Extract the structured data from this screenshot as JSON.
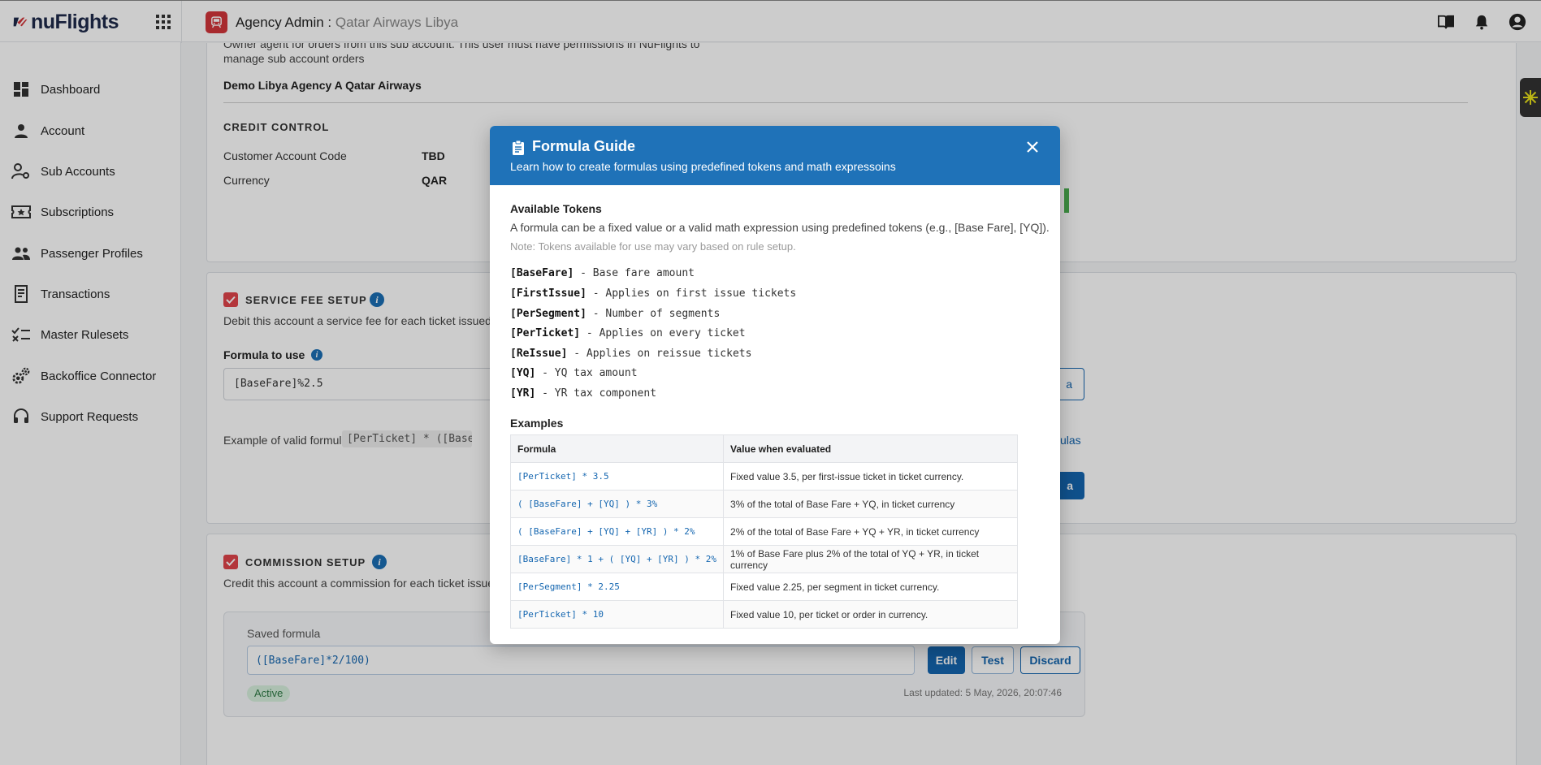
{
  "topbar": {
    "logo_text": "nuFlights",
    "agency_label": "Agency Admin : ",
    "agency_name": "Qatar Airways Libya"
  },
  "sidebar": {
    "items": [
      {
        "label": "Dashboard",
        "icon": "dashboard-icon"
      },
      {
        "label": "Account",
        "icon": "person-icon"
      },
      {
        "label": "Sub Accounts",
        "icon": "people-settings-icon"
      },
      {
        "label": "Subscriptions",
        "icon": "ticket-icon"
      },
      {
        "label": "Passenger Profiles",
        "icon": "group-icon"
      },
      {
        "label": "Transactions",
        "icon": "receipt-icon"
      },
      {
        "label": "Master Rulesets",
        "icon": "checklist-icon"
      },
      {
        "label": "Backoffice Connector",
        "icon": "gears-icon"
      },
      {
        "label": "Support Requests",
        "icon": "headset-icon"
      }
    ]
  },
  "main": {
    "owner_text_1": "Owner agent for orders from this sub account. This user must have permissions in NuFlights to",
    "owner_text_2": "manage sub account orders",
    "owner_name": "Demo Libya Agency A Qatar Airways",
    "credit_control": {
      "title": "CREDIT CONTROL",
      "customer_account_code_label": "Customer Account Code",
      "customer_account_code_value": "TBD",
      "currency_label": "Currency",
      "currency_value": "QAR"
    },
    "service_fee": {
      "title": "SERVICE FEE SETUP",
      "description": "Debit this account a service fee for each ticket issued",
      "formula_label": "Formula to use",
      "formula_value": "[BaseFare]%2.5",
      "example_label": "Example of valid formula:",
      "example_value": "[PerTicket] * ([BaseFare]",
      "right_link_fragment": "ulas",
      "right_btn_fragment": "a",
      "right_btn2_fragment": "a"
    },
    "commission": {
      "title": "COMMISSION SETUP",
      "description": "Credit this account a commission for each ticket issued",
      "saved_formula_label": "Saved formula",
      "saved_formula_value": "([BaseFare]*2/100)",
      "edit_label": "Edit",
      "test_label": "Test",
      "discard_label": "Discard",
      "status": "Active",
      "last_updated": "Last updated: 5 May, 2026, 20:07:46"
    }
  },
  "modal": {
    "title": "Formula Guide",
    "subtitle": "Learn how to create formulas using predefined tokens and math expressoins",
    "tokens_heading": "Available Tokens",
    "tokens_intro": "A formula can be a fixed value or a valid math expression using predefined tokens (e.g., [Base Fare], [YQ]).",
    "tokens_note": "Note: Tokens available for use may vary based on rule setup.",
    "tokens": [
      {
        "token": "[BaseFare]",
        "desc": " - Base fare amount"
      },
      {
        "token": "[FirstIssue]",
        "desc": " - Applies on first issue tickets"
      },
      {
        "token": "[PerSegment]",
        "desc": " - Number of segments"
      },
      {
        "token": "[PerTicket]",
        "desc": " - Applies on every ticket"
      },
      {
        "token": "[ReIssue]",
        "desc": " - Applies on reissue tickets"
      },
      {
        "token": "[YQ]",
        "desc": " - YQ tax amount"
      },
      {
        "token": "[YR]",
        "desc": " - YR tax component"
      }
    ],
    "examples_heading": "Examples",
    "table_headers": [
      "Formula",
      "Value when evaluated"
    ],
    "examples": [
      {
        "formula": "[PerTicket] * 3.5",
        "value": "Fixed value 3.5, per first-issue ticket in ticket currency."
      },
      {
        "formula": "( [BaseFare] + [YQ] ) * 3%",
        "value": "3% of the total of Base Fare + YQ, in ticket currency"
      },
      {
        "formula": "( [BaseFare] + [YQ] + [YR] ) * 2%",
        "value": "2% of the total of Base Fare + YQ + YR, in ticket currency"
      },
      {
        "formula": "[BaseFare] * 1 + ( [YQ] + [YR] ) * 2%",
        "value": "1% of Base Fare plus 2% of the total of YQ + YR, in ticket currency"
      },
      {
        "formula": "[PerSegment] * 2.25",
        "value": "Fixed value 2.25, per segment in ticket currency."
      },
      {
        "formula": "[PerTicket] * 10",
        "value": "Fixed value 10, per ticket or order in currency."
      }
    ]
  },
  "colors": {
    "brand_blue": "#1f72b8",
    "brand_red": "#d3353a",
    "active_green": "#2f7b45"
  }
}
